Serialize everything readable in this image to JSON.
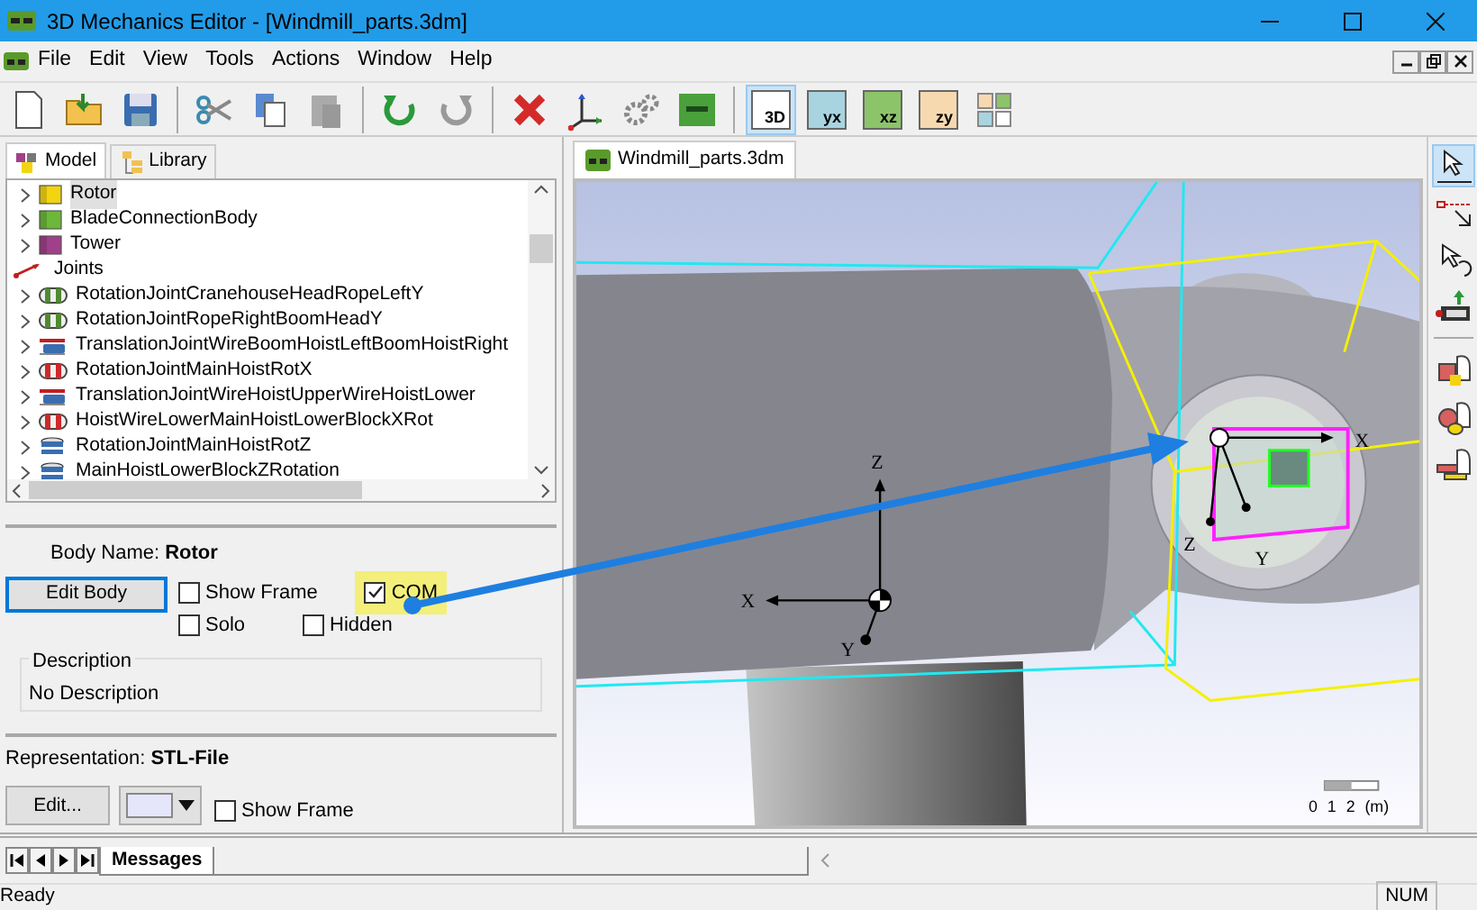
{
  "window": {
    "title": "3D Mechanics Editor - [Windmill_parts.3dm]"
  },
  "menu": [
    "File",
    "Edit",
    "View",
    "Tools",
    "Actions",
    "Window",
    "Help"
  ],
  "toolbar": [
    {
      "kind": "new"
    },
    {
      "kind": "open"
    },
    {
      "kind": "save"
    },
    {
      "kind": "sep"
    },
    {
      "kind": "cut"
    },
    {
      "kind": "copy"
    },
    {
      "kind": "paste"
    },
    {
      "kind": "sep"
    },
    {
      "kind": "undo"
    },
    {
      "kind": "redo"
    },
    {
      "kind": "sep"
    },
    {
      "kind": "delete"
    },
    {
      "kind": "axes"
    },
    {
      "kind": "gears"
    },
    {
      "kind": "sim"
    },
    {
      "kind": "sep"
    },
    {
      "kind": "view",
      "label": "3D",
      "selected": true
    },
    {
      "kind": "view",
      "label": "yx",
      "selected": false
    },
    {
      "kind": "view",
      "label": "xz",
      "selected": false
    },
    {
      "kind": "view",
      "label": "zy",
      "selected": false
    },
    {
      "kind": "layout",
      "selected": false
    }
  ],
  "left_panel": {
    "tabs": [
      {
        "label": "Model",
        "selected": true
      },
      {
        "label": "Library",
        "selected": false
      }
    ],
    "tree": [
      {
        "label": "Rotor",
        "kind": "body",
        "color": "#f2d410",
        "selected": true
      },
      {
        "label": "BladeConnectionBody",
        "kind": "body",
        "color": "#6cb83a",
        "selected": false
      },
      {
        "label": "Tower",
        "kind": "body",
        "color": "#a0408a",
        "selected": false
      },
      {
        "label": "Joints",
        "kind": "group",
        "selected": false,
        "children": [
          {
            "label": "RotationJointCranehouseHeadRopeLeftY",
            "kind": "rotation",
            "color": "#4f8a2e",
            "selected": false
          },
          {
            "label": "RotationJointRopeRightBoomHeadY",
            "kind": "rotation",
            "color": "#4f8a2e",
            "selected": false
          },
          {
            "label": "TranslationJointWireBoomHoistLeftBoomHoistRight",
            "kind": "translation",
            "selected": false
          },
          {
            "label": "RotationJointMainHoistRotX",
            "kind": "rotation",
            "color": "#d02828",
            "selected": false
          },
          {
            "label": "TranslationJointWireHoistUpperWireHoistLower",
            "kind": "translation",
            "selected": false
          },
          {
            "label": "HoistWireLowerMainHoistLowerBlockXRot",
            "kind": "rotation",
            "color": "#d02828",
            "selected": false
          },
          {
            "label": "RotationJointMainHoistRotZ",
            "kind": "rotation-z",
            "selected": false
          },
          {
            "label": "MainHoistLowerBlockZRotation",
            "kind": "rotation-z",
            "selected": false
          }
        ]
      }
    ]
  },
  "body": {
    "name": "Body Name: **Rotor**",
    "edit_button": "Edit Body",
    "checkboxes": [
      {
        "label": "Show Frame",
        "checked": false,
        "highlighted": false
      },
      {
        "label": "COM",
        "checked": true,
        "highlighted": true
      },
      {
        "label": "Solo",
        "checked": false,
        "highlighted": false
      },
      {
        "label": "Hidden",
        "checked": false,
        "highlighted": false
      }
    ],
    "description": {
      "legend": "Description",
      "text": "No Description"
    }
  },
  "representation": {
    "text": "Representation: **STL-File**",
    "edit_button": "Edit...",
    "color": "#e6e6fa",
    "show_frame": {
      "label": "Show Frame",
      "checked": false
    }
  },
  "document_tab": {
    "label": "Windmill_parts.3dm"
  },
  "viewport": {
    "axis_labels": [
      "Z",
      "X",
      "Y",
      "X",
      "Z",
      "Y"
    ],
    "scale_label": "0 1 2 (m)"
  },
  "right_toolbar": [
    {
      "kind": "select",
      "selected": true
    },
    {
      "kind": "pick",
      "selected": false
    },
    {
      "kind": "rotate",
      "selected": false
    },
    {
      "kind": "camera",
      "selected": false
    },
    {
      "kind": "sep"
    },
    {
      "kind": "shape-box",
      "selected": false
    },
    {
      "kind": "shape-sphere",
      "selected": false
    },
    {
      "kind": "shape-plate",
      "selected": false
    }
  ],
  "messages_tab": {
    "label": "Messages"
  },
  "status_bar": {
    "text": "Ready",
    "indicator": "NUM"
  }
}
